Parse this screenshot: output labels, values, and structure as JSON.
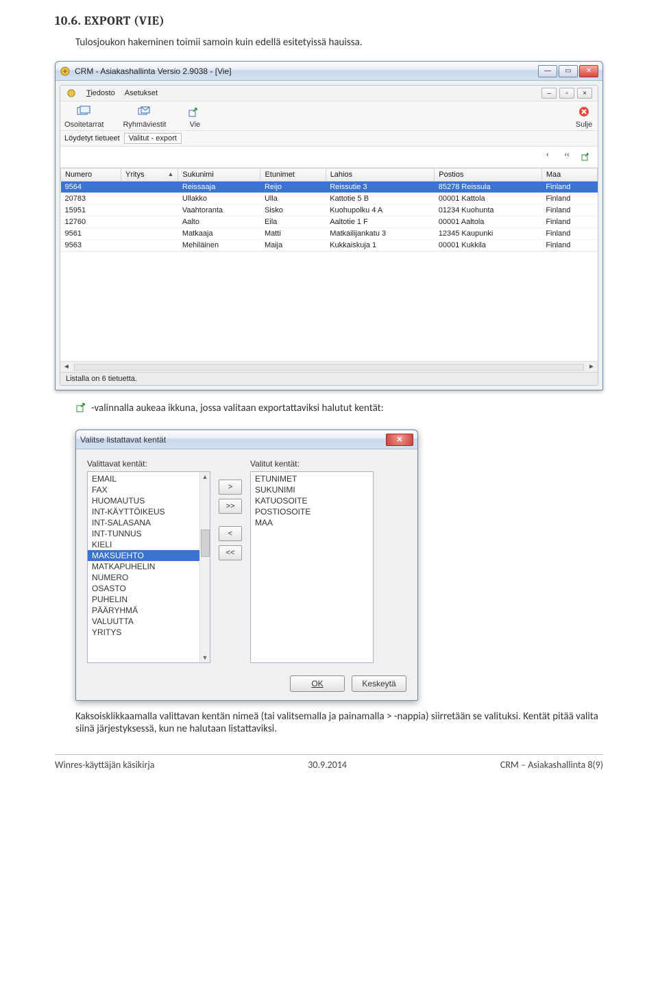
{
  "heading": "10.6. EXPORT (VIE)",
  "intro": "Tulosjoukon hakeminen toimii samoin kuin edellä esitetyissä hauissa.",
  "window": {
    "title": "CRM - Asiakashallinta Versio 2.9038 - [Vie]",
    "outer_menu": [
      "Tiedosto",
      "Asetukset"
    ],
    "inner_menu": [
      "Tiedosto",
      "Asetukset"
    ],
    "tools": {
      "osoitetarrat": "Osoitetarrat",
      "ryhmaviestit": "Ryhmäviestit",
      "vie": "Vie",
      "sulje": "Sulje"
    },
    "found_label": "Löydetyt tietueet",
    "found_chip": "Valitut - export",
    "nav_prev": "‹",
    "nav_first": "‹‹",
    "columns": [
      "Numero",
      "Yritys",
      "Sukunimi",
      "Etunimet",
      "Lahios",
      "Postios",
      "Maa"
    ],
    "rows": [
      {
        "sel": true,
        "c": [
          "9564",
          "",
          "Reissaaja",
          "Reijo",
          "Reissutie 3",
          "85278 Reissula",
          "Finland"
        ]
      },
      {
        "sel": false,
        "c": [
          "20783",
          "",
          "Ullakko",
          "Ulla",
          "Kattotie 5 B",
          "00001 Kattola",
          "Finland"
        ]
      },
      {
        "sel": false,
        "c": [
          "15951",
          "",
          "Vaahtoranta",
          "Sisko",
          "Kuohupolku 4 A",
          "01234 Kuohunta",
          "Finland"
        ]
      },
      {
        "sel": false,
        "c": [
          "12760",
          "",
          "Aalto",
          "Eila",
          "Aaltotie 1 F",
          "00001 Aaltola",
          "Finland"
        ]
      },
      {
        "sel": false,
        "c": [
          "9561",
          "",
          "Matkaaja",
          "Matti",
          "Matkailijankatu 3",
          "12345 Kaupunki",
          "Finland"
        ]
      },
      {
        "sel": false,
        "c": [
          "9563",
          "",
          "Mehiläinen",
          "Maija",
          "Kukkaiskuja 1",
          "00001 Kukkila",
          "Finland"
        ]
      }
    ],
    "statusbar": "Listalla on 6 tietuetta."
  },
  "between_text": "-valinnalla aukeaa ikkuna, jossa valitaan exportattaviksi halutut kentät:",
  "dialog": {
    "title": "Valitse listattavat kentät",
    "available_label": "Valittavat kentät:",
    "selected_label": "Valitut kentät:",
    "available": [
      "EMAIL",
      "FAX",
      "HUOMAUTUS",
      "INT-KÄYTTÖIKEUS",
      "INT-SALASANA",
      "INT-TUNNUS",
      "KIELI",
      "MAKSUEHTO",
      "MATKAPUHELIN",
      "NUMERO",
      "OSASTO",
      "PUHELIN",
      "PÄÄRYHMÄ",
      "VALUUTTA",
      "YRITYS"
    ],
    "available_selected_index": 7,
    "selected": [
      "ETUNIMET",
      "SUKUNIMI",
      "KATUOSOITE",
      "POSTIOSOITE",
      "MAA"
    ],
    "btn_add": ">",
    "btn_add_all": ">>",
    "btn_remove": "<",
    "btn_remove_all": "<<",
    "ok": "OK",
    "cancel": "Keskeytä"
  },
  "after_text": "Kaksoisklikkaamalla valittavan kentän nimeä (tai valitsemalla ja painamalla > -nappia) siirretään se valituksi. Kentät pitää valita siinä järjestyksessä, kun ne halutaan listattaviksi.",
  "footer": {
    "left": "Winres-käyttäjän käsikirja",
    "center": "30.9.2014",
    "right": "CRM – Asiakashallinta  8(9)"
  }
}
